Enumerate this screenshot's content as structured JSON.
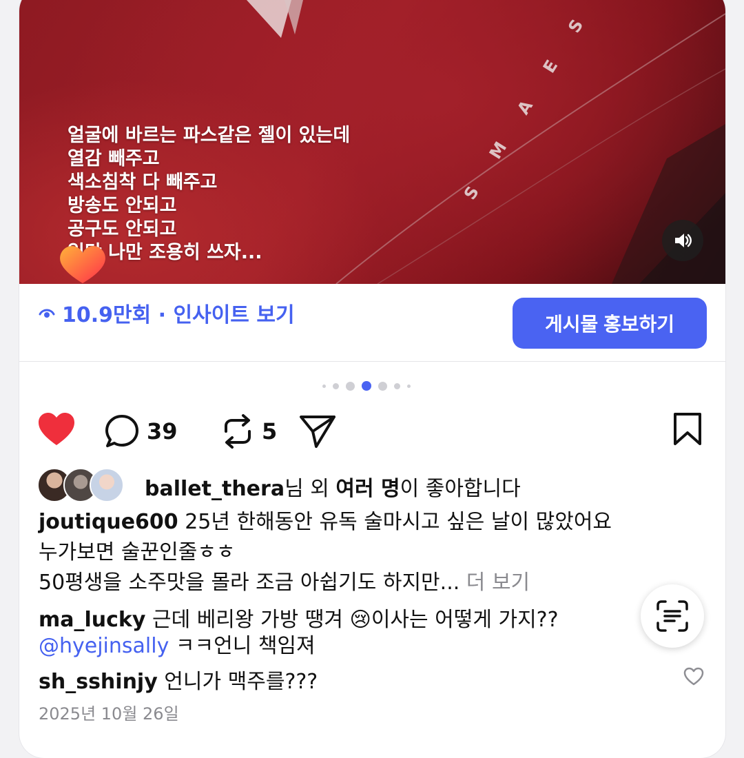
{
  "media": {
    "caption_lines": [
      "얼굴에 바르는 파스같은 젤이 있는데",
      "열감 빼주고",
      "색소침착 다 빼주고",
      "방송도 안되고",
      "공구도 안되고",
      "일단 나만 조용히 쓰자..."
    ],
    "brand_text": "S M A E S T H E T I"
  },
  "insight": {
    "views_label": "10.9만회 · 인사이트 보기",
    "promote_label": "게시물 홍보하기"
  },
  "actions": {
    "comments_count": "39",
    "reposts_count": "5"
  },
  "likes": {
    "user": "ballet_thera",
    "text_mid": "님 외 ",
    "others": "여러 명",
    "text_end": "이 좋아합니다"
  },
  "post": {
    "author": "joutique600",
    "line1": " 25년 한해동안 유독 술마시고 싶은 날이 많았어요",
    "line2": "누가보면 술꾼인줄ㅎㅎ",
    "line3": "50평생을 소주맛을 몰라 조금 아쉽기도 하지만...",
    "more": " 더 보기"
  },
  "comments": [
    {
      "user": "ma_lucky",
      "text_a": " 근데 베리왕 가방 땡겨 ",
      "emoji": "😢",
      "text_b": "이사는 어떻게 가지??"
    },
    {
      "mention": "@hyejinsally",
      "text": "  ㅋㅋ언니 책임져"
    },
    {
      "user": "sh_sshinjy",
      "text": " 언니가 맥주를???"
    }
  ],
  "date": "2025년 10월 26일",
  "colors": {
    "accent": "#4a63f2",
    "like": "#ef2f3c"
  }
}
